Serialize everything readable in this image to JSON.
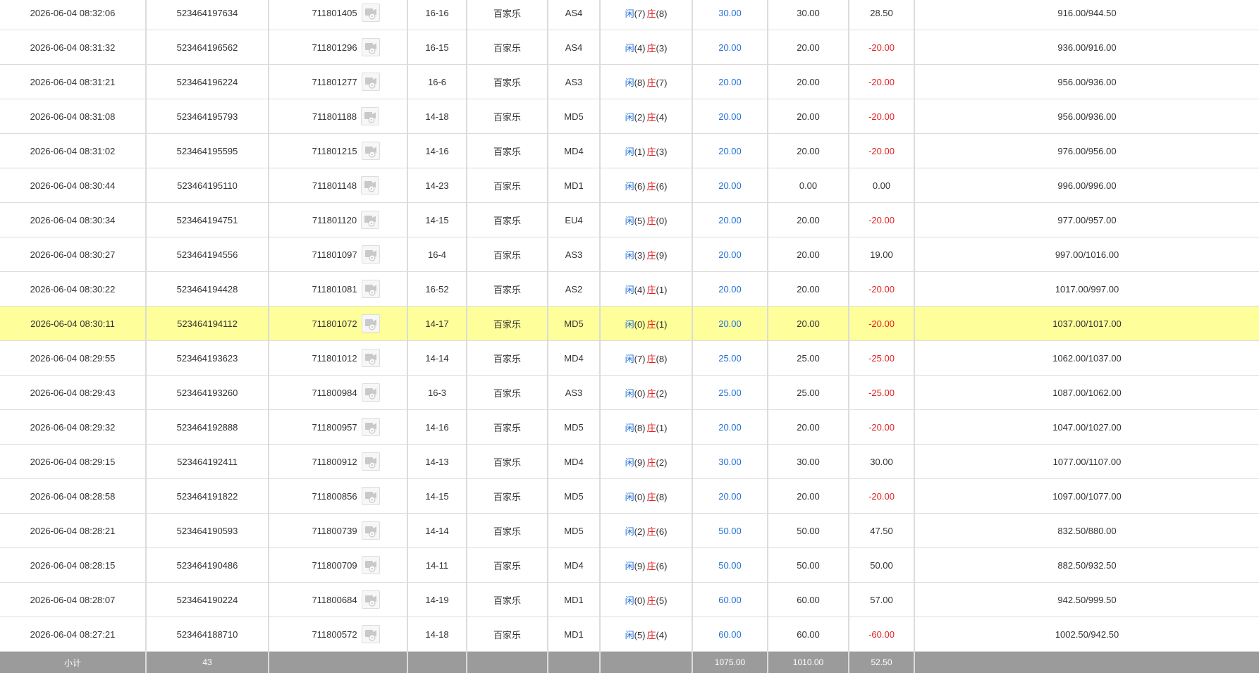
{
  "table": {
    "rows": [
      {
        "time": "2026-06-04 08:32:06",
        "bet_id": "523464197634",
        "round": "711801405",
        "shoe": "16-16",
        "game": "百家乐",
        "table": "AS4",
        "player_label": "闲",
        "player_score": "(7)",
        "banker_label": "庄",
        "banker_score": "(8)",
        "bet": "30.00",
        "valid": "30.00",
        "win": "28.50",
        "win_type": "pos",
        "balance": "916.00/944.50",
        "highlight": false
      },
      {
        "time": "2026-06-04 08:31:32",
        "bet_id": "523464196562",
        "round": "711801296",
        "shoe": "16-15",
        "game": "百家乐",
        "table": "AS4",
        "player_label": "闲",
        "player_score": "(4)",
        "banker_label": "庄",
        "banker_score": "(3)",
        "bet": "20.00",
        "valid": "20.00",
        "win": "-20.00",
        "win_type": "neg",
        "balance": "936.00/916.00",
        "highlight": false
      },
      {
        "time": "2026-06-04 08:31:21",
        "bet_id": "523464196224",
        "round": "711801277",
        "shoe": "16-6",
        "game": "百家乐",
        "table": "AS3",
        "player_label": "闲",
        "player_score": "(8)",
        "banker_label": "庄",
        "banker_score": "(7)",
        "bet": "20.00",
        "valid": "20.00",
        "win": "-20.00",
        "win_type": "neg",
        "balance": "956.00/936.00",
        "highlight": false
      },
      {
        "time": "2026-06-04 08:31:08",
        "bet_id": "523464195793",
        "round": "711801188",
        "shoe": "14-18",
        "game": "百家乐",
        "table": "MD5",
        "player_label": "闲",
        "player_score": "(2)",
        "banker_label": "庄",
        "banker_score": "(4)",
        "bet": "20.00",
        "valid": "20.00",
        "win": "-20.00",
        "win_type": "neg",
        "balance": "956.00/936.00",
        "highlight": false
      },
      {
        "time": "2026-06-04 08:31:02",
        "bet_id": "523464195595",
        "round": "711801215",
        "shoe": "14-16",
        "game": "百家乐",
        "table": "MD4",
        "player_label": "闲",
        "player_score": "(1)",
        "banker_label": "庄",
        "banker_score": "(3)",
        "bet": "20.00",
        "valid": "20.00",
        "win": "-20.00",
        "win_type": "neg",
        "balance": "976.00/956.00",
        "highlight": false
      },
      {
        "time": "2026-06-04 08:30:44",
        "bet_id": "523464195110",
        "round": "711801148",
        "shoe": "14-23",
        "game": "百家乐",
        "table": "MD1",
        "player_label": "闲",
        "player_score": "(6)",
        "banker_label": "庄",
        "banker_score": "(6)",
        "bet": "20.00",
        "valid": "0.00",
        "win": "0.00",
        "win_type": "pos",
        "balance": "996.00/996.00",
        "highlight": false
      },
      {
        "time": "2026-06-04 08:30:34",
        "bet_id": "523464194751",
        "round": "711801120",
        "shoe": "14-15",
        "game": "百家乐",
        "table": "EU4",
        "player_label": "闲",
        "player_score": "(5)",
        "banker_label": "庄",
        "banker_score": "(0)",
        "bet": "20.00",
        "valid": "20.00",
        "win": "-20.00",
        "win_type": "neg",
        "balance": "977.00/957.00",
        "highlight": false
      },
      {
        "time": "2026-06-04 08:30:27",
        "bet_id": "523464194556",
        "round": "711801097",
        "shoe": "16-4",
        "game": "百家乐",
        "table": "AS3",
        "player_label": "闲",
        "player_score": "(3)",
        "banker_label": "庄",
        "banker_score": "(9)",
        "bet": "20.00",
        "valid": "20.00",
        "win": "19.00",
        "win_type": "pos",
        "balance": "997.00/1016.00",
        "highlight": false
      },
      {
        "time": "2026-06-04 08:30:22",
        "bet_id": "523464194428",
        "round": "711801081",
        "shoe": "16-52",
        "game": "百家乐",
        "table": "AS2",
        "player_label": "闲",
        "player_score": "(4)",
        "banker_label": "庄",
        "banker_score": "(1)",
        "bet": "20.00",
        "valid": "20.00",
        "win": "-20.00",
        "win_type": "neg",
        "balance": "1017.00/997.00",
        "highlight": false
      },
      {
        "time": "2026-06-04 08:30:11",
        "bet_id": "523464194112",
        "round": "711801072",
        "shoe": "14-17",
        "game": "百家乐",
        "table": "MD5",
        "player_label": "闲",
        "player_score": "(0)",
        "banker_label": "庄",
        "banker_score": "(1)",
        "bet": "20.00",
        "valid": "20.00",
        "win": "-20.00",
        "win_type": "neg",
        "balance": "1037.00/1017.00",
        "highlight": true
      },
      {
        "time": "2026-06-04 08:29:55",
        "bet_id": "523464193623",
        "round": "711801012",
        "shoe": "14-14",
        "game": "百家乐",
        "table": "MD4",
        "player_label": "闲",
        "player_score": "(7)",
        "banker_label": "庄",
        "banker_score": "(8)",
        "bet": "25.00",
        "valid": "25.00",
        "win": "-25.00",
        "win_type": "neg",
        "balance": "1062.00/1037.00",
        "highlight": false
      },
      {
        "time": "2026-06-04 08:29:43",
        "bet_id": "523464193260",
        "round": "711800984",
        "shoe": "16-3",
        "game": "百家乐",
        "table": "AS3",
        "player_label": "闲",
        "player_score": "(0)",
        "banker_label": "庄",
        "banker_score": "(2)",
        "bet": "25.00",
        "valid": "25.00",
        "win": "-25.00",
        "win_type": "neg",
        "balance": "1087.00/1062.00",
        "highlight": false
      },
      {
        "time": "2026-06-04 08:29:32",
        "bet_id": "523464192888",
        "round": "711800957",
        "shoe": "14-16",
        "game": "百家乐",
        "table": "MD5",
        "player_label": "闲",
        "player_score": "(8)",
        "banker_label": "庄",
        "banker_score": "(1)",
        "bet": "20.00",
        "valid": "20.00",
        "win": "-20.00",
        "win_type": "neg",
        "balance": "1047.00/1027.00",
        "highlight": false
      },
      {
        "time": "2026-06-04 08:29:15",
        "bet_id": "523464192411",
        "round": "711800912",
        "shoe": "14-13",
        "game": "百家乐",
        "table": "MD4",
        "player_label": "闲",
        "player_score": "(9)",
        "banker_label": "庄",
        "banker_score": "(2)",
        "bet": "30.00",
        "valid": "30.00",
        "win": "30.00",
        "win_type": "pos",
        "balance": "1077.00/1107.00",
        "highlight": false
      },
      {
        "time": "2026-06-04 08:28:58",
        "bet_id": "523464191822",
        "round": "711800856",
        "shoe": "14-15",
        "game": "百家乐",
        "table": "MD5",
        "player_label": "闲",
        "player_score": "(0)",
        "banker_label": "庄",
        "banker_score": "(8)",
        "bet": "20.00",
        "valid": "20.00",
        "win": "-20.00",
        "win_type": "neg",
        "balance": "1097.00/1077.00",
        "highlight": false
      },
      {
        "time": "2026-06-04 08:28:21",
        "bet_id": "523464190593",
        "round": "711800739",
        "shoe": "14-14",
        "game": "百家乐",
        "table": "MD5",
        "player_label": "闲",
        "player_score": "(2)",
        "banker_label": "庄",
        "banker_score": "(6)",
        "bet": "50.00",
        "valid": "50.00",
        "win": "47.50",
        "win_type": "pos",
        "balance": "832.50/880.00",
        "highlight": false
      },
      {
        "time": "2026-06-04 08:28:15",
        "bet_id": "523464190486",
        "round": "711800709",
        "shoe": "14-11",
        "game": "百家乐",
        "table": "MD4",
        "player_label": "闲",
        "player_score": "(9)",
        "banker_label": "庄",
        "banker_score": "(6)",
        "bet": "50.00",
        "valid": "50.00",
        "win": "50.00",
        "win_type": "pos",
        "balance": "882.50/932.50",
        "highlight": false
      },
      {
        "time": "2026-06-04 08:28:07",
        "bet_id": "523464190224",
        "round": "711800684",
        "shoe": "14-19",
        "game": "百家乐",
        "table": "MD1",
        "player_label": "闲",
        "player_score": "(0)",
        "banker_label": "庄",
        "banker_score": "(5)",
        "bet": "60.00",
        "valid": "60.00",
        "win": "57.00",
        "win_type": "pos",
        "balance": "942.50/999.50",
        "highlight": false
      },
      {
        "time": "2026-06-04 08:27:21",
        "bet_id": "523464188710",
        "round": "711800572",
        "shoe": "14-18",
        "game": "百家乐",
        "table": "MD1",
        "player_label": "闲",
        "player_score": "(5)",
        "banker_label": "庄",
        "banker_score": "(4)",
        "bet": "60.00",
        "valid": "60.00",
        "win": "-60.00",
        "win_type": "neg",
        "balance": "1002.50/942.50",
        "highlight": false
      }
    ]
  },
  "subtotal": {
    "label": "小计",
    "count": "43",
    "bet_total": "1075.00",
    "valid_total": "1010.00",
    "win_total": "52.50"
  },
  "colors": {
    "player": "#1f6fd6",
    "banker": "#e02020",
    "negative": "#e02020",
    "highlight_row": "#fefe9a",
    "subtotal_bg": "#9b9b9b"
  },
  "icons": {
    "round_video": "video-replay-icon"
  }
}
